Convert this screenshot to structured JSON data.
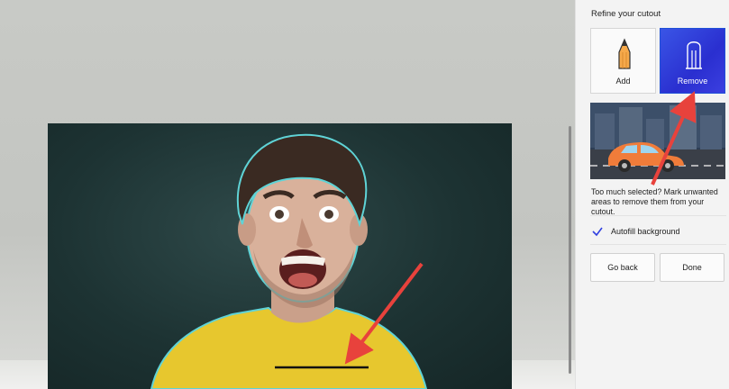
{
  "panel": {
    "title": "Refine your cutout",
    "tools": [
      {
        "label": "Add",
        "icon": "pencil-icon",
        "selected": false
      },
      {
        "label": "Remove",
        "icon": "eraser-icon",
        "selected": true
      }
    ],
    "hint": "Too much selected? Mark unwanted areas to remove them from your cutout.",
    "autofill_label": "Autofill background",
    "autofill_checked": true,
    "back_label": "Go back",
    "done_label": "Done"
  },
  "colors": {
    "accent": "#2f3fe0",
    "annotation_arrow": "#e8423c",
    "cutout_outline": "#5fd3d6"
  }
}
